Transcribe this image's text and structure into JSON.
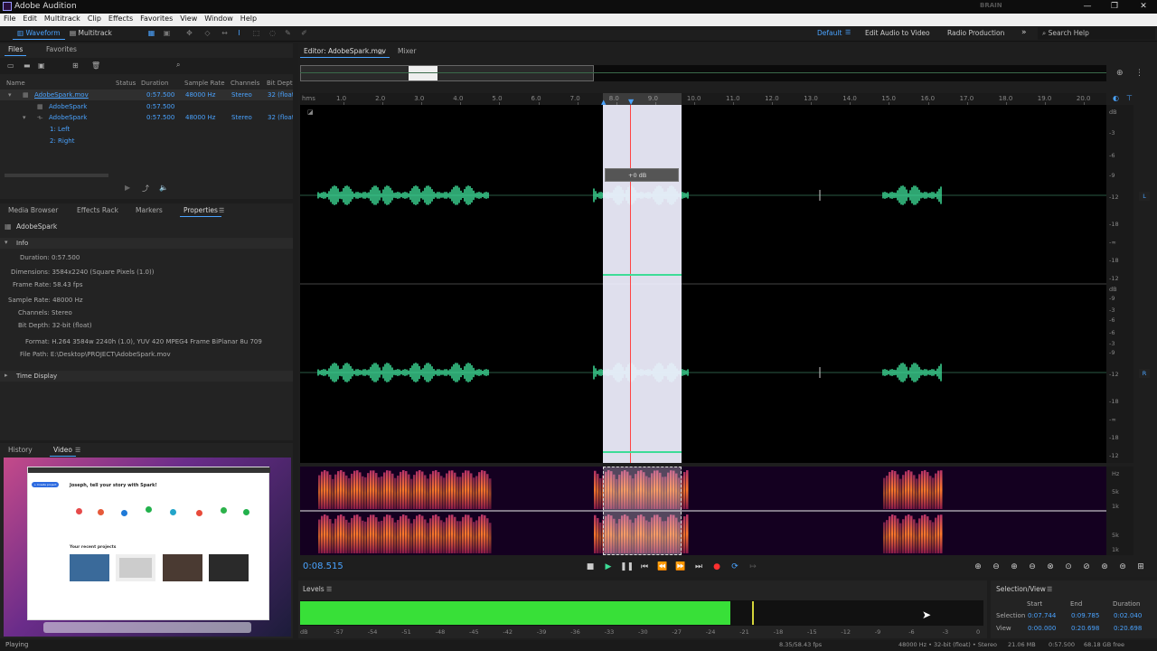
{
  "app": {
    "title": "Adobe Audition",
    "watermark": "BRAIN"
  },
  "menu": [
    "File",
    "Edit",
    "Multitrack",
    "Clip",
    "Effects",
    "Favorites",
    "View",
    "Window",
    "Help"
  ],
  "toolbar": {
    "waveform_label": "Waveform",
    "multitrack_label": "Multitrack"
  },
  "workspaces": {
    "default": "Default",
    "edit_audio_to_video": "Edit Audio to Video",
    "radio_production": "Radio Production",
    "search_placeholder": "Search Help"
  },
  "files_panel": {
    "tabs": [
      "Files",
      "Favorites"
    ],
    "columns": [
      "Name",
      "Status",
      "Duration",
      "Sample Rate",
      "Channels",
      "Bit Depth"
    ],
    "rows": [
      {
        "name": "AdobeSpark.mov",
        "duration": "0:57.500",
        "sample_rate": "48000 Hz",
        "channels": "Stereo",
        "bit_depth": "32 (float)"
      },
      {
        "name": "AdobeSpark",
        "duration": "0:57.500",
        "sample_rate": "",
        "channels": "",
        "bit_depth": ""
      },
      {
        "name": "AdobeSpark",
        "duration": "0:57.500",
        "sample_rate": "48000 Hz",
        "channels": "Stereo",
        "bit_depth": "32 (float)"
      },
      {
        "name": "1: Left",
        "duration": "",
        "sample_rate": "",
        "channels": "",
        "bit_depth": ""
      },
      {
        "name": "2: Right",
        "duration": "",
        "sample_rate": "",
        "channels": "",
        "bit_depth": ""
      }
    ]
  },
  "props_panel": {
    "tabs": [
      "Media Browser",
      "Effects Rack",
      "Markers",
      "Properties"
    ],
    "item": "AdobeSpark",
    "section_info": "Info",
    "duration": "Duration:  0:57.500",
    "dimensions": "Dimensions:  3584x2240 (Square Pixels (1.0))",
    "frame_rate": "Frame Rate:  58.43 fps",
    "sample_rate": "Sample Rate:  48000 Hz",
    "channels": "Channels:  Stereo",
    "bit_depth": "Bit Depth:  32-bit (float)",
    "format": "Format:  H.264 3584w 2240h (1.0), YUV 420 MPEG4 Frame BiPlanar 8u 709",
    "file_path": "File Path:  E:\\Desktop\\PROJECT\\AdobeSpark.mov",
    "section_time": "Time Display"
  },
  "video_panel": {
    "tabs": [
      "History",
      "Video"
    ],
    "preview": {
      "heading": "Joseph, tell your story with Spark!",
      "recent": "Your recent projects",
      "create": "+ Create project"
    }
  },
  "editor": {
    "tabs": [
      "Editor: AdobeSpark.mov",
      "Mixer"
    ],
    "ruler_unit": "hms",
    "ruler": [
      "1.0",
      "2.0",
      "3.0",
      "4.0",
      "5.0",
      "6.0",
      "7.0",
      "8.0",
      "9.0",
      "10.0",
      "11.0",
      "12.0",
      "13.0",
      "14.0",
      "15.0",
      "16.0",
      "17.0",
      "18.0",
      "19.0",
      "20.0"
    ],
    "db_scale": [
      "dB",
      "-3",
      "-6",
      "-9",
      "-12",
      "-18",
      "-∞",
      "-18",
      "-12",
      "-9",
      "-6",
      "-3"
    ],
    "hud": "+0 dB",
    "hz_scale": [
      "Hz",
      "5k",
      "1k",
      "5k",
      "1k"
    ],
    "channel_left": "L",
    "channel_right": "R",
    "current_time": "0:08.515"
  },
  "levels": {
    "label": "Levels",
    "level_fraction": 0.63,
    "scale": [
      "dB",
      "-57",
      "-54",
      "-51",
      "-48",
      "-45",
      "-42",
      "-39",
      "-36",
      "-33",
      "-30",
      "-27",
      "-24",
      "-21",
      "-18",
      "-15",
      "-12",
      "-9",
      "-6",
      "-3",
      "0"
    ]
  },
  "selection_view": {
    "label": "Selection/View",
    "headers": [
      "Start",
      "End",
      "Duration"
    ],
    "selection": {
      "label": "Selection",
      "start": "0:07.744",
      "end": "0:09.785",
      "duration": "0:02.040"
    },
    "view": {
      "label": "View",
      "start": "0:00.000",
      "end": "0:20.698",
      "duration": "0:20.698"
    }
  },
  "status": {
    "left": "Playing",
    "fps": "8.35/58.43 fps",
    "format": "48000 Hz • 32-bit (float) • Stereo",
    "size": "21.06 MB",
    "duration": "0:57.500",
    "free": "68.18 GB free"
  },
  "colors": {
    "accent": "#4aa3ff",
    "waveform": "#3ddc97",
    "meter": "#38e038",
    "playhead": "#ff4444"
  }
}
